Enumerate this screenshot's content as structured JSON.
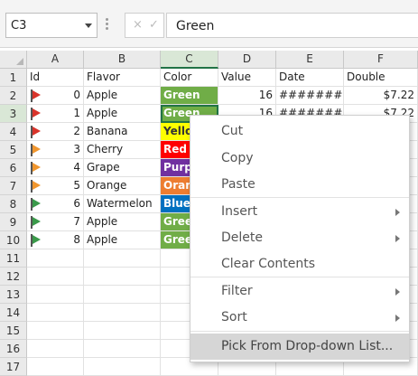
{
  "namebox": {
    "value": "C3"
  },
  "formula": {
    "value": "Green"
  },
  "fx": {
    "cancel": "×",
    "confirm": "✓"
  },
  "columns": [
    "A",
    "B",
    "C",
    "D",
    "E",
    "F"
  ],
  "rows": [
    "1",
    "2",
    "3",
    "4",
    "5",
    "6",
    "7",
    "8",
    "9",
    "10",
    "11",
    "12",
    "13",
    "14",
    "15",
    "16",
    "17"
  ],
  "header_row": {
    "a": "Id",
    "b": "Flavor",
    "c": "Color",
    "d": "Value",
    "e": "Date",
    "f": "Double"
  },
  "data_rows": [
    {
      "id": "0",
      "flavor": "Apple",
      "color": "Green",
      "color_hex": "#70ad47",
      "value": "16",
      "date": "##########",
      "double": "$7.22",
      "flag": "#d9342b"
    },
    {
      "id": "1",
      "flavor": "Apple",
      "color": "Green",
      "color_hex": "#70ad47",
      "value": "16",
      "date": "##########",
      "double": "$7.22",
      "flag": "#d9342b"
    },
    {
      "id": "2",
      "flavor": "Banana",
      "color": "Yellow",
      "color_hex": "#ffff00",
      "value": "",
      "date": "",
      "double": "",
      "flag": "#d9342b"
    },
    {
      "id": "3",
      "flavor": "Cherry",
      "color": "Red",
      "color_hex": "#ff0000",
      "value": "",
      "date": "",
      "double": "",
      "flag": "#f0962e"
    },
    {
      "id": "4",
      "flavor": "Grape",
      "color": "Purple",
      "color_hex": "#7030a0",
      "value": "",
      "date": "",
      "double": "",
      "flag": "#f0962e"
    },
    {
      "id": "5",
      "flavor": "Orange",
      "color": "Orange",
      "color_hex": "#ed7d31",
      "value": "",
      "date": "",
      "double": "",
      "flag": "#f0962e"
    },
    {
      "id": "6",
      "flavor": "Watermelon",
      "color": "Blue",
      "color_hex": "#0070c0",
      "value": "",
      "date": "",
      "double": "",
      "flag": "#3a9a4a"
    },
    {
      "id": "7",
      "flavor": "Apple",
      "color": "Green",
      "color_hex": "#70ad47",
      "value": "",
      "date": "",
      "double": "",
      "flag": "#3a9a4a"
    },
    {
      "id": "8",
      "flavor": "Apple",
      "color": "Green",
      "color_hex": "#70ad47",
      "value": "",
      "date": "",
      "double": "",
      "flag": "#3a9a4a"
    }
  ],
  "context_menu": {
    "items": [
      {
        "label": "Cut",
        "submenu": false,
        "highlighted": false
      },
      {
        "label": "Copy",
        "submenu": false,
        "highlighted": false
      },
      {
        "label": "Paste",
        "submenu": false,
        "highlighted": false
      },
      {
        "label": "Insert",
        "submenu": true,
        "highlighted": false
      },
      {
        "label": "Delete",
        "submenu": true,
        "highlighted": false
      },
      {
        "label": "Clear Contents",
        "submenu": false,
        "highlighted": false
      },
      {
        "label": "Filter",
        "submenu": true,
        "highlighted": false
      },
      {
        "label": "Sort",
        "submenu": true,
        "highlighted": false
      },
      {
        "label": "Pick From Drop-down List...",
        "submenu": false,
        "highlighted": true
      }
    ]
  },
  "selection": {
    "cell": "C3",
    "accent": "#217346"
  }
}
